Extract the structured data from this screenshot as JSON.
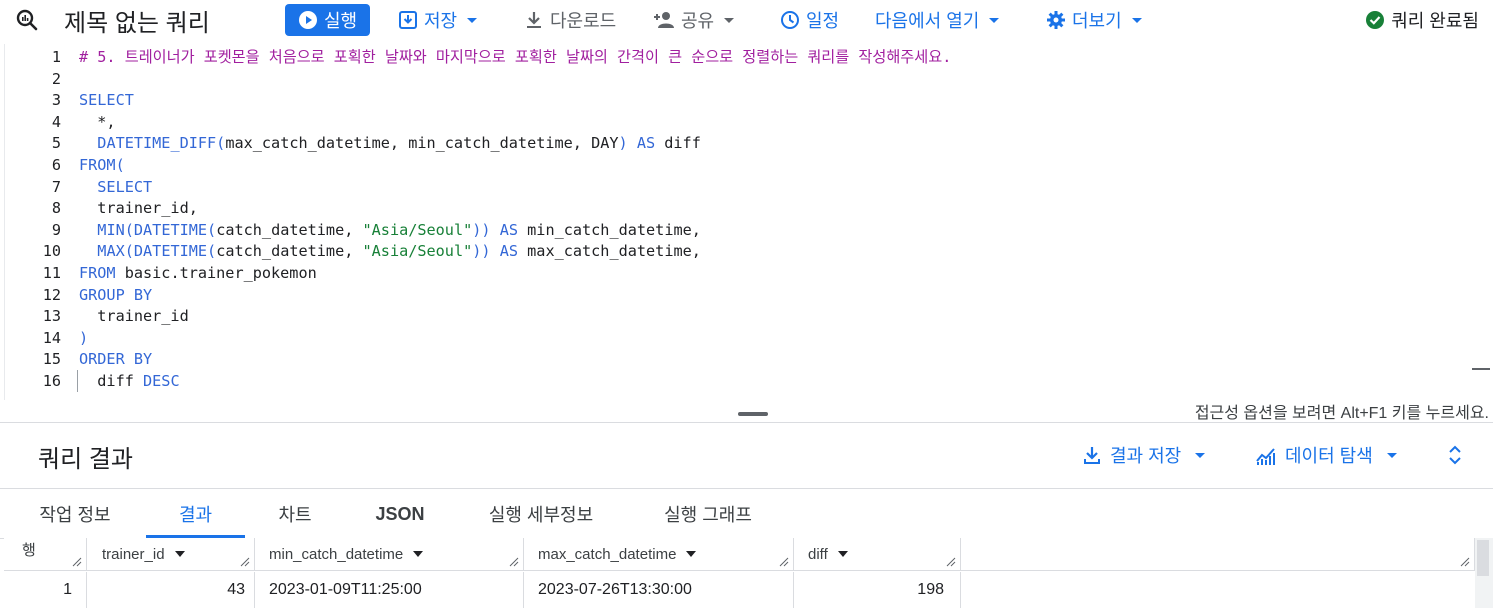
{
  "toolbar": {
    "title": "제목 없는 쿼리",
    "run_label": "실행",
    "save_label": "저장",
    "download_label": "다운로드",
    "share_label": "공유",
    "schedule_label": "일정",
    "open_in_label": "다음에서 열기",
    "more_label": "더보기",
    "status_label": "쿼리 완료됨"
  },
  "editor": {
    "line_numbers": [
      "1",
      "2",
      "3",
      "4",
      "5",
      "6",
      "7",
      "8",
      "9",
      "10",
      "11",
      "12",
      "13",
      "14",
      "15",
      "16"
    ],
    "lines": [
      "# 5. 트레이너가 포켓몬을 처음으로 포획한 날짜와 마지막으로 포획한 날짜의 간격이 큰 순으로 정렬하는 쿼리를 작성해주세요.",
      "",
      "SELECT",
      "  *,",
      "  DATETIME_DIFF(max_catch_datetime, min_catch_datetime, DAY) AS diff",
      "FROM(",
      "  SELECT",
      "  trainer_id,",
      "  MIN(DATETIME(catch_datetime, \"Asia/Seoul\")) AS min_catch_datetime,",
      "  MAX(DATETIME(catch_datetime, \"Asia/Seoul\")) AS max_catch_datetime,",
      "FROM basic.trainer_pokemon",
      "GROUP BY",
      "  trainer_id",
      ")",
      "ORDER BY",
      "  diff DESC"
    ],
    "accessibility_hint": "접근성 옵션을 보려면 Alt+F1 키를 누르세요."
  },
  "results": {
    "title": "쿼리 결과",
    "save_results_label": "결과 저장",
    "explore_data_label": "데이터 탐색",
    "tabs": [
      "작업 정보",
      "결과",
      "차트",
      "JSON",
      "실행 세부정보",
      "실행 그래프"
    ],
    "active_tab": "결과",
    "columns": [
      "행",
      "trainer_id",
      "min_catch_datetime",
      "max_catch_datetime",
      "diff"
    ],
    "rows": [
      [
        "1",
        "43",
        "2023-01-09T11:25:00",
        "2023-07-26T13:30:00",
        "198"
      ]
    ]
  },
  "colors": {
    "accent": "#1a73e8",
    "keyword": "#3367d6",
    "string": "#188038",
    "comment": "#a11f9f",
    "success": "#188038"
  }
}
